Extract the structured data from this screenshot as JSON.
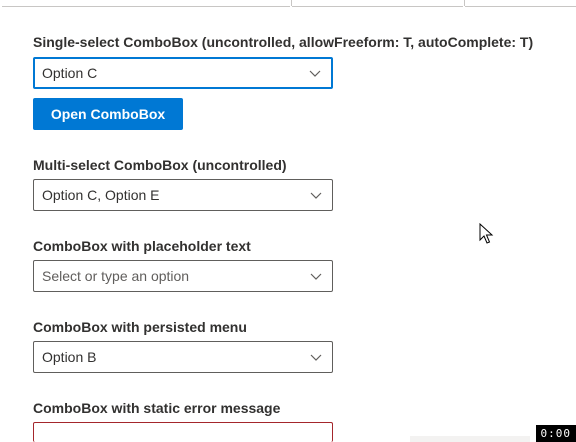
{
  "sections": {
    "single": {
      "label": "Single-select ComboBox (uncontrolled, allowFreeform: T, autoComplete: T)",
      "value": "Option C",
      "button_label": "Open ComboBox"
    },
    "multi": {
      "label": "Multi-select ComboBox (uncontrolled)",
      "value": "Option C, Option E"
    },
    "placeholder": {
      "label": "ComboBox with placeholder text",
      "placeholder": "Select or type an option"
    },
    "persisted": {
      "label": "ComboBox with persisted menu",
      "value": "Option B"
    },
    "error": {
      "label": "ComboBox with static error message"
    }
  },
  "video_timer": "0:00",
  "colors": {
    "primary": "#0078d4",
    "border": "#605e5c",
    "error": "#a4262c",
    "text": "#323130"
  },
  "icons": {
    "chevron": "chevron-down-icon",
    "cursor": "mouse-pointer-icon"
  }
}
